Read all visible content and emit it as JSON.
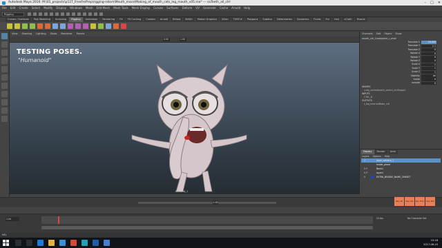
{
  "window": {
    "title": "Autodesk Maya 2016: M:\\01_projects\\p127_FreeFrePrep\\rigging-rotom\\Mouth_mace\\Making_of_mouth_cats_leg_mouth_v05.ma* --- saTeeth_all_ctrl",
    "controls": [
      "–",
      "□",
      "✕"
    ]
  },
  "menubar": [
    "File",
    "Edit",
    "Create",
    "Select",
    "Modify",
    "Display",
    "Windows",
    "Mesh",
    "Edit Mesh",
    "Mesh Tools",
    "Mesh Display",
    "Curves",
    "Surfaces",
    "Deform",
    "UV",
    "Generate",
    "Cache",
    "Arnold",
    "Help"
  ],
  "status_line": {
    "mode": "Rigging"
  },
  "shelf_tabs": [
    "Curves / Surfaces",
    "Poly Modeling",
    "Sculpting",
    "Rigging",
    "Animation",
    "Rendering",
    "FX",
    "FX Caching",
    "Custom",
    "Arnold",
    "Bifrost",
    "MASH",
    "Motion Graphics",
    "XGen",
    "TURTLE",
    "Polygons",
    "Subdivs",
    "Deformation",
    "Dynamics",
    "Fluids",
    "Fur",
    "Hair",
    "nCloth",
    "Muscle"
  ],
  "shelf_active": "Rigging",
  "panel_menu": [
    "View",
    "Shading",
    "Lighting",
    "Show",
    "Renderer",
    "Panels"
  ],
  "panel_fields": {
    "near": "0.00",
    "far": "1.00"
  },
  "viewport": {
    "heading": "TESTING POSES.",
    "subheading": "\"Humanoid\"",
    "camera_label": "CAMERA_1"
  },
  "channel_box": {
    "tabs": [
      "Channels",
      "Edit",
      "Object",
      "Show"
    ],
    "object_name": "mouth_ctrl_Contolpoint_r_vmid",
    "attributes": [
      {
        "name": "Translate X",
        "value": "14.000",
        "highlight": true
      },
      {
        "name": "Translate Y",
        "value": "1.1"
      },
      {
        "name": "Translate Z",
        "value": "0"
      },
      {
        "name": "Rotate X",
        "value": "0"
      },
      {
        "name": "Rotate Y",
        "value": "0"
      },
      {
        "name": "Rotate Z",
        "value": "0"
      },
      {
        "name": "Scale X",
        "value": "1"
      },
      {
        "name": "Scale Y",
        "value": "1"
      },
      {
        "name": "Scale Z",
        "value": "1"
      },
      {
        "name": "Visibility",
        "value": "on"
      },
      {
        "name": "inside",
        "value": "0"
      },
      {
        "name": "outside",
        "value": "0"
      }
    ],
    "sections": [
      {
        "label": "SHAPES",
        "sub": false
      },
      {
        "label": "curly_smileAtteath_sketch_ctrlShape1",
        "sub": true
      },
      {
        "label": "INPUTS",
        "sub": false
      },
      {
        "label": "CTRL_B",
        "sub": true
      },
      {
        "label": "OUTPUTS",
        "sub": false
      },
      {
        "label": "t_leg_InternalMode_init",
        "sub": true
      }
    ]
  },
  "layer_editor": {
    "tabs": [
      "Display",
      "Render",
      "Anim"
    ],
    "active_tab": "Display",
    "menu": [
      "Layers",
      "Options",
      "Help"
    ],
    "layers": [
      {
        "vis": "V",
        "color": "#5b93c9",
        "name": "layer_camera_1",
        "selected": true
      },
      {
        "vis": "",
        "color": "#444444",
        "name": "Inside_plane"
      },
      {
        "vis": "V P",
        "color": "#444444",
        "name": "Bank1"
      },
      {
        "vis": "V P",
        "color": "#444444",
        "name": "layer1"
      },
      {
        "vis": "V",
        "color": "#2b3fd6",
        "name": "EXTRA_BUDDIE_NAME_TARGET"
      }
    ]
  },
  "time_slider": {
    "current_frame": "1.00",
    "key_buttons": [
      "Key All",
      "Key Sel",
      "Key Tran",
      "Key Rot"
    ]
  },
  "range_slider": {
    "start_field": "1.00",
    "fps": "24 fps",
    "character_set": "No Character Set"
  },
  "command_line": {
    "label": "MEL"
  },
  "taskbar": {
    "apps": [
      {
        "icon": "search-icon",
        "color": "#2a2f36"
      },
      {
        "icon": "taskview-icon",
        "color": "#2a2f36"
      },
      {
        "icon": "edge-icon",
        "color": "#1e7bd6"
      },
      {
        "icon": "folder-icon",
        "color": "#e3b341"
      },
      {
        "icon": "store-icon",
        "color": "#3b8ed6"
      },
      {
        "icon": "chrome-icon",
        "color": "#d44a3a"
      },
      {
        "icon": "maya-icon",
        "color": "#23a0b4"
      },
      {
        "icon": "photoshop-icon",
        "color": "#1f5fa8"
      },
      {
        "icon": "mail-icon",
        "color": "#4a7fd0"
      }
    ],
    "time": "15:18",
    "date": "2017-06-15"
  }
}
